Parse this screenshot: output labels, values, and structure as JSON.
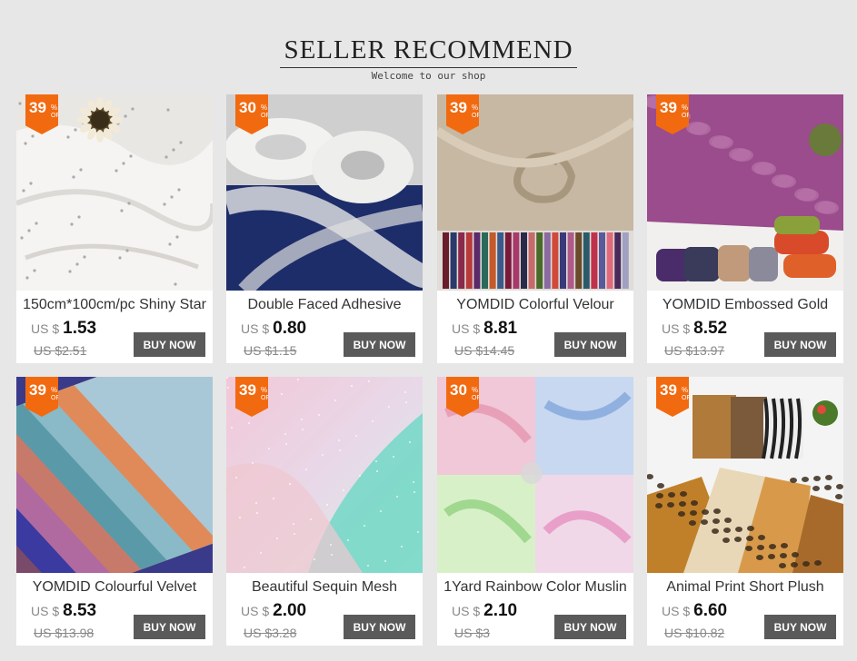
{
  "header": {
    "title": "SELLER RECOMMEND",
    "subtitle": "Welcome to our shop"
  },
  "currency_label": "US $",
  "badge_suffix": {
    "percent": "%",
    "off": "OFF"
  },
  "buy_label": "BUY NOW",
  "products": [
    {
      "title": "150cm*100cm/pc Shiny Star",
      "discount": "39",
      "price": "1.53",
      "old_price": "US $2.51",
      "art": "tulle-stars"
    },
    {
      "title": "Double Faced Adhesive",
      "discount": "30",
      "price": "0.80",
      "old_price": "US $1.15",
      "art": "adhesive-rolls"
    },
    {
      "title": "YOMDID Colorful Velour",
      "discount": "39",
      "price": "8.81",
      "old_price": "US $14.45",
      "art": "velour"
    },
    {
      "title": "YOMDID Embossed Gold",
      "discount": "39",
      "price": "8.52",
      "old_price": "US $13.97",
      "art": "embossed"
    },
    {
      "title": "YOMDID Colourful Velvet",
      "discount": "39",
      "price": "8.53",
      "old_price": "US $13.98",
      "art": "velvet"
    },
    {
      "title": "Beautiful Sequin Mesh",
      "discount": "39",
      "price": "2.00",
      "old_price": "US $3.28",
      "art": "sequin-mesh"
    },
    {
      "title": "1Yard Rainbow Color Muslin",
      "discount": "30",
      "price": "2.10",
      "old_price": "US $3",
      "art": "rainbow-muslin"
    },
    {
      "title": "Animal Print Short Plush",
      "discount": "39",
      "price": "6.60",
      "old_price": "US $10.82",
      "art": "animal-print"
    }
  ]
}
